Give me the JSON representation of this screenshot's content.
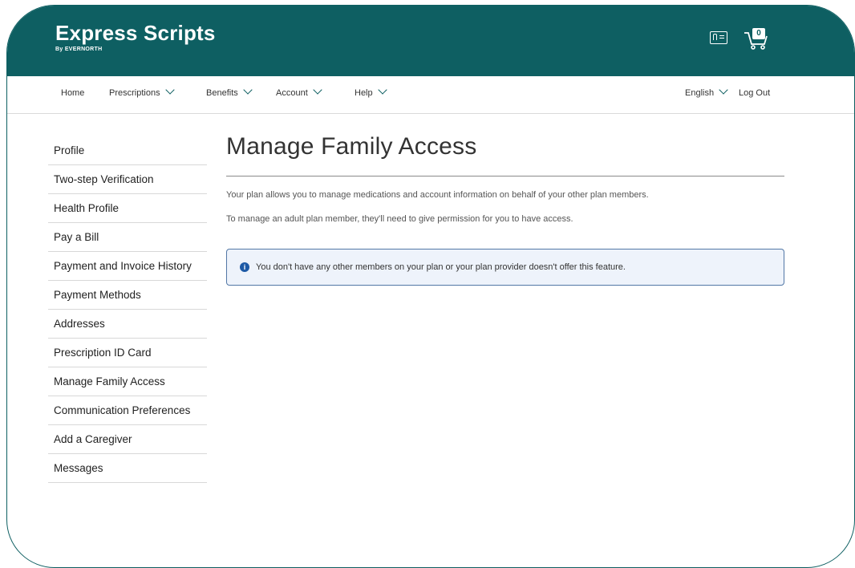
{
  "brand": {
    "name": "Express Scripts",
    "sub_prefix": "By",
    "sub_name": "EVERNORTH"
  },
  "header": {
    "cart_count": "0",
    "idcard_icon": "id-card-icon",
    "cart_icon": "cart-icon"
  },
  "nav": {
    "left": [
      "Home",
      "Prescriptions",
      "Benefits",
      "Account",
      "Help"
    ],
    "right": [
      "English",
      "Log Out"
    ]
  },
  "sidebar": {
    "items": [
      "Profile",
      "Two-step Verification",
      "Health Profile",
      "Pay a Bill",
      "Payment and Invoice History",
      "Payment Methods",
      "Addresses",
      "Prescription ID Card",
      "Manage Family Access",
      "Communication Preferences",
      "Add a Caregiver",
      "Messages"
    ]
  },
  "main": {
    "title": "Manage Family Access",
    "para1": "Your plan allows you to manage medications and account information on behalf of your other plan members.",
    "para2": "To manage an adult plan member, they'll need to give permission for you to have access.",
    "alert_icon": "info-icon",
    "alert_text": "You don't have any other members on your plan or your plan provider doesn't offer this feature."
  },
  "colors": {
    "brand": "#0e5f62",
    "alert_border": "#5277a6",
    "alert_bg": "#eef3fb",
    "info": "#1e5aa6"
  }
}
